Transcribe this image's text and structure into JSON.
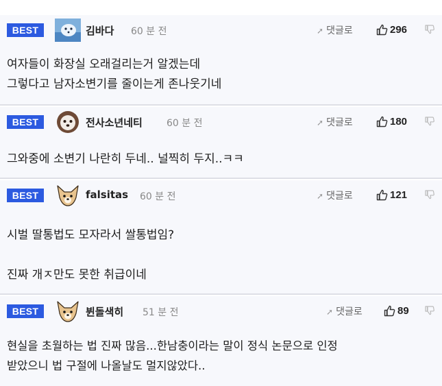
{
  "comments": [
    {
      "badge": "BEST",
      "nickname": "김바다",
      "time": "60 분 전",
      "reply_label": "댓글로",
      "likes": "296",
      "avatar": "snow-animal-avatar",
      "lines": [
        "여자들이 화장실 오래걸리는거 알겠는데",
        "그렇다고 남자소변기를 줄이는게 존나웃기네"
      ]
    },
    {
      "badge": "BEST",
      "nickname": "전사소년네티",
      "time": "60 분 전",
      "reply_label": "댓글로",
      "likes": "180",
      "avatar": "dog-fluffy-avatar",
      "lines": [
        "그와중에 소변기 나란히 두네.. 널찍히 두지..ㅋㅋ"
      ]
    },
    {
      "badge": "BEST",
      "nickname": "falsitas",
      "time": "60 분 전",
      "reply_label": "댓글로",
      "likes": "121",
      "avatar": "chihuahua-avatar",
      "lines": [
        "시벌 딸통법도 모자라서 쌀통법임?",
        "",
        "진짜 개ㅈ만도 못한 취급이네"
      ]
    },
    {
      "badge": "BEST",
      "nickname": "뷘돌색히",
      "time": "51 분 전",
      "reply_label": "댓글로",
      "likes": "89",
      "avatar": "chihuahua-avatar",
      "lines": [
        "현실을 초월하는 법 진짜 많음...한남충이라는 말이 정식 논문으로 인정",
        "받았으니 법 구절에 나올날도 멀지않았다.."
      ]
    }
  ],
  "colors": {
    "badge_bg": "#2c5ae0",
    "row_bg": "#f7f8fc",
    "separator": "#dedfe6"
  }
}
